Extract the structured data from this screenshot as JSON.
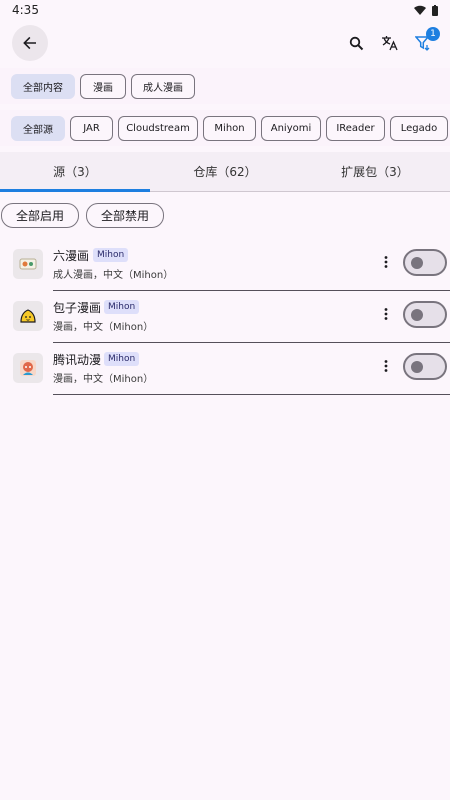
{
  "status": {
    "time": "4:35"
  },
  "topbar": {
    "filter_badge": "1",
    "icons": [
      "arrow-back-icon",
      "search-icon",
      "translate-icon",
      "filter-icon"
    ]
  },
  "content_chips": [
    "全部内容",
    "漫画",
    "成人漫画"
  ],
  "source_chips": [
    "全部源",
    "JAR",
    "Cloudstream",
    "Mihon",
    "Aniyomi",
    "IReader",
    "Legado"
  ],
  "tabs": [
    "源（3）",
    "仓库（62）",
    "扩展包（3）"
  ],
  "actions": {
    "enable_all": "全部启用",
    "disable_all": "全部禁用"
  },
  "sources": [
    {
      "name": "六漫画",
      "tag": "Mihon",
      "sub": "成人漫画，中文（Mihon）",
      "enabled": false
    },
    {
      "name": "包子漫画",
      "tag": "Mihon",
      "sub": "漫画，中文（Mihon）",
      "enabled": false
    },
    {
      "name": "腾讯动漫",
      "tag": "Mihon",
      "sub": "漫画，中文（Mihon）",
      "enabled": false
    }
  ],
  "colors": {
    "accent": "#1e7fe0",
    "selected_chip": "#dcdff3",
    "background": "#fcf6fc"
  }
}
